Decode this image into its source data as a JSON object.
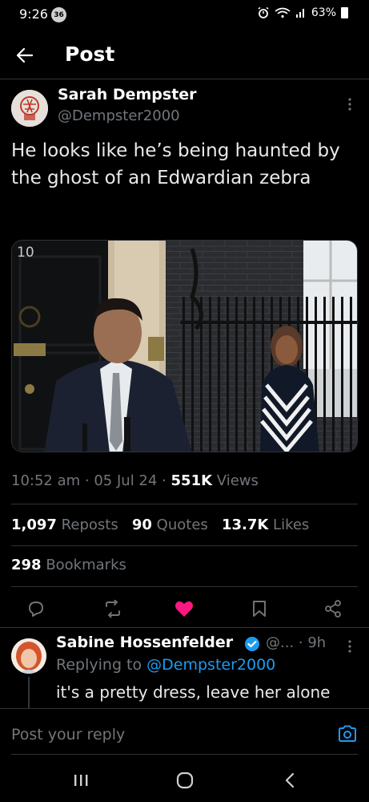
{
  "status_bar": {
    "time": "9:26",
    "notification_count": "36",
    "battery": "63%"
  },
  "header": {
    "title": "Post"
  },
  "post": {
    "author_name": "Sarah Dempster",
    "author_handle": "@Dempster2000",
    "text": "He looks like he’s being haunted by the ghost of an Edwardian zebra",
    "media_door_number": "10",
    "time": "10:52 am",
    "date": "05 Jul 24",
    "views_count": "551K",
    "views_label": "Views",
    "reposts_count": "1,097",
    "reposts_label": "Reposts",
    "quotes_count": "90",
    "quotes_label": "Quotes",
    "likes_count": "13.7K",
    "likes_label": "Likes",
    "bookmarks_count": "298",
    "bookmarks_label": "Bookmarks"
  },
  "reply": {
    "author_name": "Sabine Hossenfelder",
    "author_handle": "@...",
    "time": "9h",
    "replying_to_label": "Replying to",
    "replying_to_handle": "@Dempster2000",
    "text": "it's a pretty dress, leave her alone"
  },
  "compose": {
    "placeholder": "Post your reply"
  },
  "colors": {
    "accent": "#1d9bf0",
    "like": "#f91880",
    "background": "#000000",
    "secondary_text": "#71767b"
  }
}
